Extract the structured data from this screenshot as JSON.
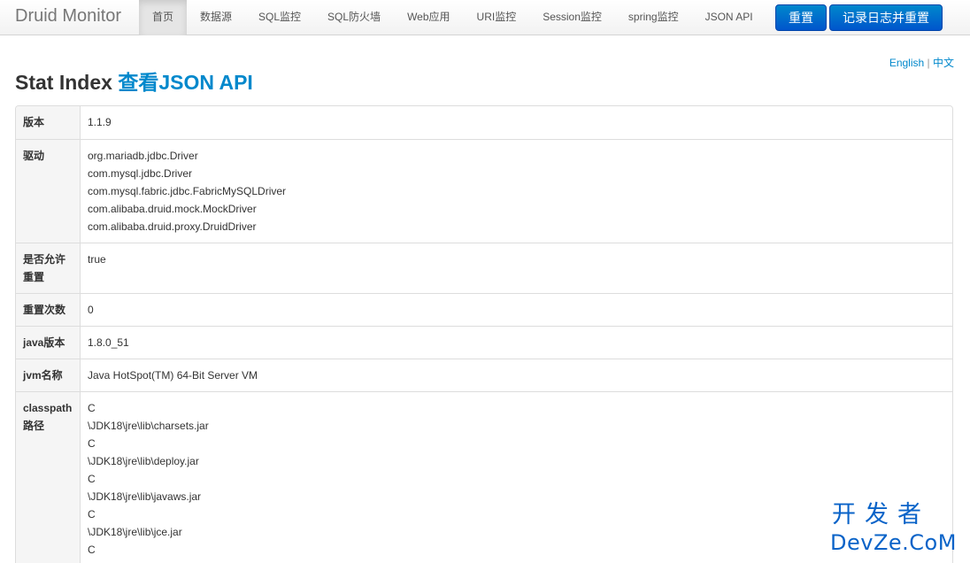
{
  "navbar": {
    "brand": "Druid Monitor",
    "items": [
      {
        "label": "首页",
        "active": true
      },
      {
        "label": "数据源",
        "active": false
      },
      {
        "label": "SQL监控",
        "active": false
      },
      {
        "label": "SQL防火墙",
        "active": false
      },
      {
        "label": "Web应用",
        "active": false
      },
      {
        "label": "URI监控",
        "active": false
      },
      {
        "label": "Session监控",
        "active": false
      },
      {
        "label": "spring监控",
        "active": false
      },
      {
        "label": "JSON API",
        "active": false
      }
    ],
    "reset_button": "重置",
    "log_reset_button": "记录日志并重置"
  },
  "lang": {
    "english": "English",
    "separator": "|",
    "chinese": "中文"
  },
  "title": {
    "text": "Stat Index",
    "link": "查看JSON API"
  },
  "stats": {
    "version": {
      "key": "版本",
      "value": "1.1.9"
    },
    "drivers": {
      "key": "驱动",
      "values": [
        "org.mariadb.jdbc.Driver",
        "com.mysql.jdbc.Driver",
        "com.mysql.fabric.jdbc.FabricMySQLDriver",
        "com.alibaba.druid.mock.MockDriver",
        "com.alibaba.druid.proxy.DruidDriver"
      ]
    },
    "reset_enable": {
      "key_line1": "是否允许",
      "key_line2": "重置",
      "value": "true"
    },
    "reset_count": {
      "key": "重置次数",
      "value": "0"
    },
    "java_version": {
      "key": "java版本",
      "value": "1.8.0_51"
    },
    "jvm_name": {
      "key": "jvm名称",
      "value": "Java HotSpot(TM) 64-Bit Server VM"
    },
    "classpath": {
      "key_line1": "classpath",
      "key_line2": "路径",
      "values": [
        "C",
        "\\JDK18\\jre\\lib\\charsets.jar",
        "C",
        "\\JDK18\\jre\\lib\\deploy.jar",
        "C",
        "\\JDK18\\jre\\lib\\javaws.jar",
        "C",
        "\\JDK18\\jre\\lib\\jce.jar",
        "C"
      ]
    }
  },
  "watermark": {
    "cn": "开发者",
    "en": "DevZe.CoM"
  }
}
